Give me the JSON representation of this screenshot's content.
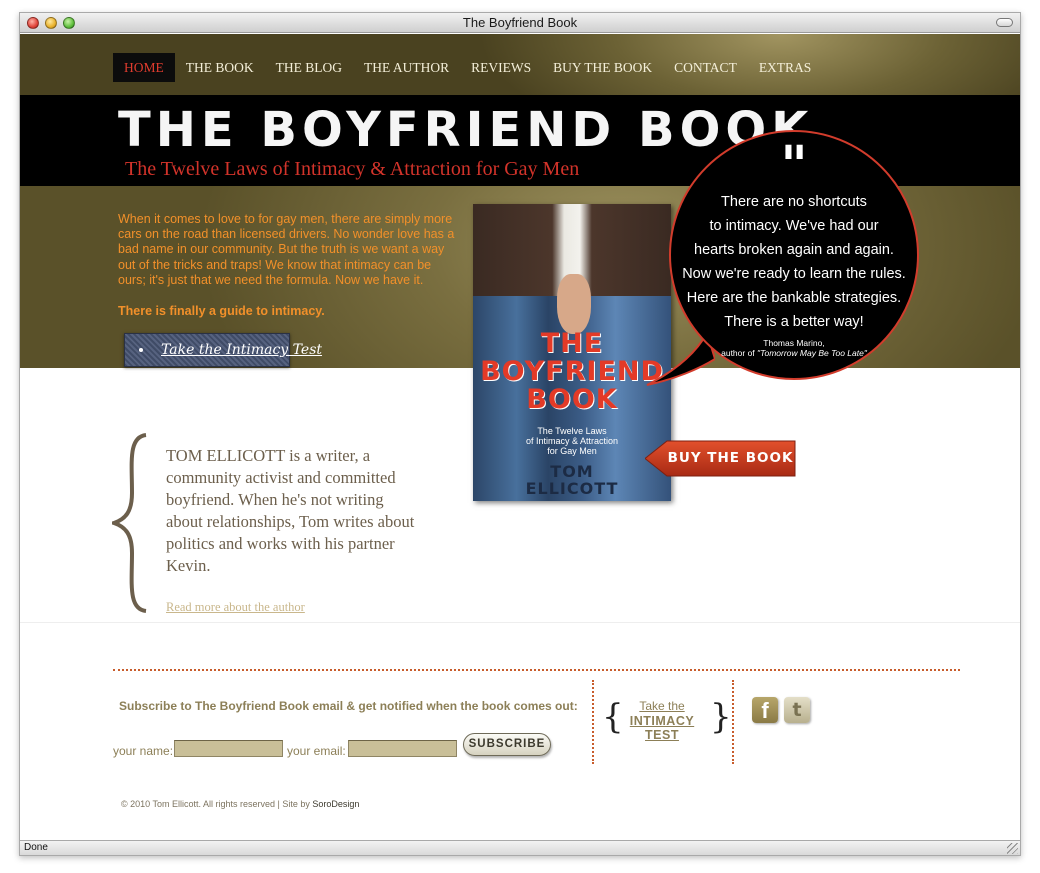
{
  "window": {
    "title": "The Boyfriend Book",
    "status": "Done"
  },
  "nav": {
    "items": [
      "HOME",
      "THE BOOK",
      "THE BLOG",
      "THE AUTHOR",
      "REVIEWS",
      "BUY THE BOOK",
      "CONTACT",
      "EXTRAS"
    ],
    "active": "HOME"
  },
  "banner": {
    "title": "THE BOYFRIEND BOOK",
    "subtitle": "The Twelve Laws of Intimacy & Attraction for Gay Men"
  },
  "intro": {
    "paragraph": "When it comes to love to for gay men, there are simply more cars on the road than licensed drivers. No wonder love has a bad name in our community. But the truth is we want a way out of the tricks and traps! We know that intimacy can be ours; it's just that we need the formula. Now we have it.",
    "emphasis": "There is finally a guide to intimacy.",
    "test_button": "Take the Intimacy Test"
  },
  "book": {
    "title_line1": "THE",
    "title_line2": "BOYFRIEND",
    "title_line3": "BOOK",
    "subtitle_line1": "The Twelve Laws",
    "subtitle_line2": "of Intimacy & Attraction",
    "subtitle_line3": "for Gay Men",
    "author_line1": "TOM",
    "author_line2": "ELLICOTT"
  },
  "quote": {
    "mark": "\"",
    "lines": [
      "There are no shortcuts",
      "to intimacy. We've had our",
      "hearts broken again and again.",
      "Now we're ready to learn the rules.",
      "Here are the bankable strategies.",
      "There is a better way!"
    ],
    "attribution_name": "Thomas Marino,",
    "attribution_prefix": "author of",
    "attribution_work": "\"Tomorrow May Be Too Late\""
  },
  "buy_button": "BUY THE BOOK",
  "author": {
    "bio": "TOM ELLICOTT is a writer, a community activist and committed boyfriend. When he's not writing about relationships, Tom writes about politics and works with his partner Kevin.",
    "link": "Read more about the author"
  },
  "footer": {
    "subscribe_text": "Subscribe to The Boyfriend Book email & get notified when the book comes out:",
    "name_label": "your name:",
    "email_label": "your email:",
    "name_value": "",
    "email_value": "",
    "subscribe_button": "SUBSCRIBE",
    "intimacy_small": "Take the",
    "intimacy_big": "INTIMACY TEST",
    "brace_open": "{",
    "brace_close": "}",
    "social": [
      {
        "name": "facebook-icon",
        "glyph": "f"
      },
      {
        "name": "twitter-icon",
        "glyph": "t"
      }
    ],
    "copyright": "© 2010 Tom Ellicott. All rights reserved | Site by",
    "designer": "SoroDesign"
  },
  "colors": {
    "nav_active": "#e03c2e",
    "accent_red": "#d2332a",
    "intro_orange": "#f2902a",
    "footer_text": "#8c7f57",
    "divider": "#c85c2c"
  }
}
